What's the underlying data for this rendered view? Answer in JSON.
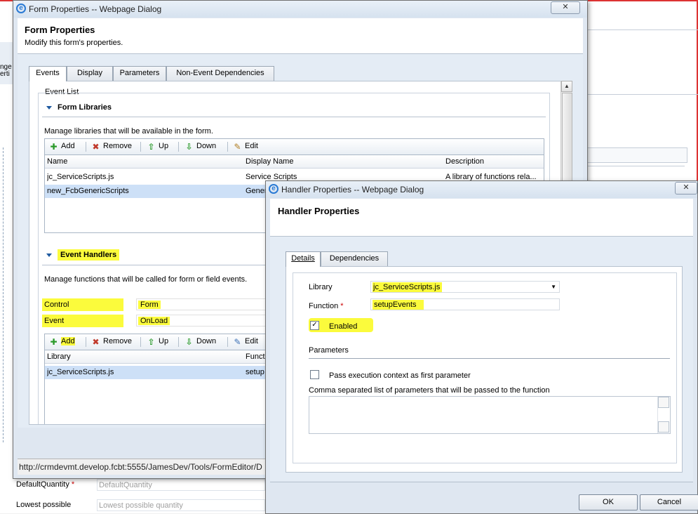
{
  "form_dialog": {
    "window_title": "Form Properties -- Webpage Dialog",
    "header_title": "Form Properties",
    "header_subtitle": "Modify this form's properties.",
    "tabs": [
      "Events",
      "Display",
      "Parameters",
      "Non-Event Dependencies"
    ],
    "event_list_label": "Event List",
    "form_libraries": {
      "heading": "Form Libraries",
      "description": "Manage libraries that will be available in the form.",
      "toolbar": {
        "add": "Add",
        "remove": "Remove",
        "up": "Up",
        "down": "Down",
        "edit": "Edit"
      },
      "columns": {
        "name": "Name",
        "display_name": "Display Name",
        "description": "Description"
      },
      "rows": [
        {
          "name": "jc_ServiceScripts.js",
          "display_name": "Service Scripts",
          "description": "A library of functions rela..."
        },
        {
          "name": "new_FcbGenericScripts",
          "display_name": "Gener",
          "description": ""
        }
      ]
    },
    "event_handlers": {
      "heading": "Event Handlers",
      "description": "Manage functions that will be called for form or field events.",
      "control_label": "Control",
      "control_value": "Form",
      "event_label": "Event",
      "event_value": "OnLoad",
      "toolbar": {
        "add": "Add",
        "remove": "Remove",
        "up": "Up",
        "down": "Down",
        "edit": "Edit"
      },
      "columns": {
        "library": "Library",
        "function": "Funct"
      },
      "rows": [
        {
          "library": "jc_ServiceScripts.js",
          "function": "setup"
        }
      ]
    },
    "status_url": "http://crmdevmt.develop.fcbt:5555/JamesDev/Tools/FormEditor/D"
  },
  "background_form": {
    "default_quantity_label": "DefaultQuantity",
    "default_quantity_placeholder": "DefaultQuantity",
    "lowest_possible_label": "Lowest possible",
    "lowest_possible_placeholder": "Lowest possible quantity",
    "left_fragment_1": "nge",
    "left_fragment_2": "erti"
  },
  "handler_dialog": {
    "window_title": "Handler Properties -- Webpage Dialog",
    "header_title": "Handler Properties",
    "tabs": [
      "Details",
      "Dependencies"
    ],
    "library_label": "Library",
    "library_value": "jc_ServiceScripts.js",
    "function_label": "Function",
    "function_value": "setupEvents",
    "enabled_label": "Enabled",
    "enabled_checked": true,
    "parameters_heading": "Parameters",
    "pass_context_label": "Pass execution context as first parameter",
    "pass_context_checked": false,
    "params_description": "Comma separated list of parameters that will be passed to the function",
    "ok_label": "OK",
    "cancel_label": "Cancel"
  },
  "colors": {
    "highlight": "#fbfb3c",
    "selected_row": "#cde0f7",
    "dialog_bg": "#dfe7f1"
  }
}
